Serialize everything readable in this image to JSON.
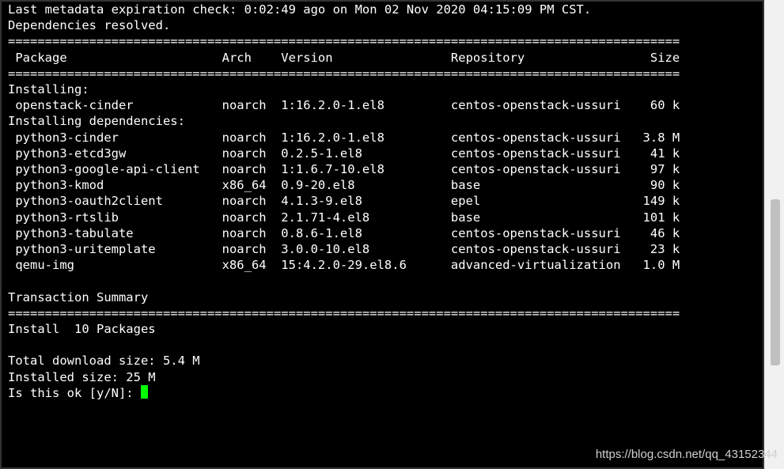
{
  "header": {
    "metadata_line": "Last metadata expiration check: 0:02:49 ago on Mon 02 Nov 2020 04:15:09 PM CST.",
    "deps_resolved": "Dependencies resolved."
  },
  "columns": {
    "package": "Package",
    "arch": "Arch",
    "version": "Version",
    "repository": "Repository",
    "size": "Size"
  },
  "sections": {
    "installing": "Installing:",
    "installing_deps": "Installing dependencies:"
  },
  "packages": {
    "installing": [
      {
        "name": "openstack-cinder",
        "arch": "noarch",
        "version": "1:16.2.0-1.el8",
        "repo": "centos-openstack-ussuri",
        "size": "60 k"
      }
    ],
    "deps": [
      {
        "name": "python3-cinder",
        "arch": "noarch",
        "version": "1:16.2.0-1.el8",
        "repo": "centos-openstack-ussuri",
        "size": "3.8 M"
      },
      {
        "name": "python3-etcd3gw",
        "arch": "noarch",
        "version": "0.2.5-1.el8",
        "repo": "centos-openstack-ussuri",
        "size": "41 k"
      },
      {
        "name": "python3-google-api-client",
        "arch": "noarch",
        "version": "1:1.6.7-10.el8",
        "repo": "centos-openstack-ussuri",
        "size": "97 k"
      },
      {
        "name": "python3-kmod",
        "arch": "x86_64",
        "version": "0.9-20.el8",
        "repo": "base",
        "size": "90 k"
      },
      {
        "name": "python3-oauth2client",
        "arch": "noarch",
        "version": "4.1.3-9.el8",
        "repo": "epel",
        "size": "149 k"
      },
      {
        "name": "python3-rtslib",
        "arch": "noarch",
        "version": "2.1.71-4.el8",
        "repo": "base",
        "size": "101 k"
      },
      {
        "name": "python3-tabulate",
        "arch": "noarch",
        "version": "0.8.6-1.el8",
        "repo": "centos-openstack-ussuri",
        "size": "46 k"
      },
      {
        "name": "python3-uritemplate",
        "arch": "noarch",
        "version": "3.0.0-10.el8",
        "repo": "centos-openstack-ussuri",
        "size": "23 k"
      },
      {
        "name": "qemu-img",
        "arch": "x86_64",
        "version": "15:4.2.0-29.el8.6",
        "repo": "advanced-virtualization",
        "size": "1.0 M"
      }
    ]
  },
  "footer": {
    "txn_summary": "Transaction Summary",
    "install_count": "Install  10 Packages",
    "download_size": "Total download size: 5.4 M",
    "installed_size": "Installed size: 25 M",
    "prompt": "Is this ok [y/N]: "
  },
  "watermark": "https://blog.csdn.net/qq_43152344",
  "layout": {
    "col_name": 1,
    "col_arch": 29,
    "col_ver": 37,
    "col_repo": 60,
    "col_size_right": 91,
    "rule_width": 91
  }
}
